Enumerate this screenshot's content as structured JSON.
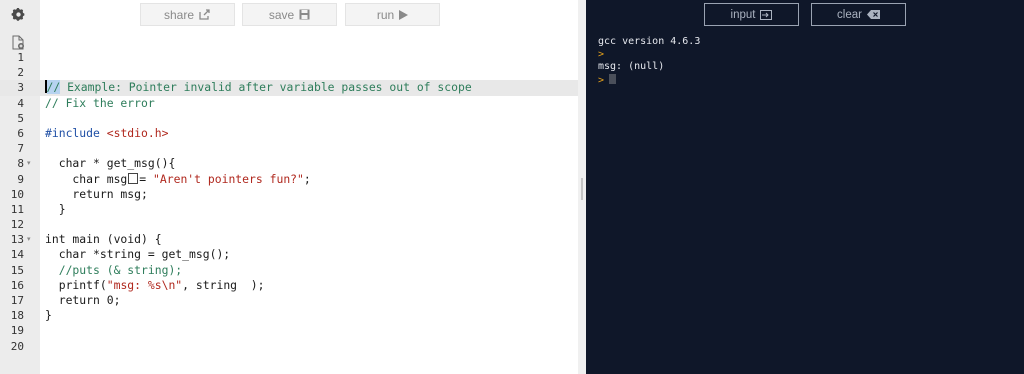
{
  "toolbar": {
    "share_label": "share",
    "save_label": "save",
    "run_label": "run"
  },
  "console_toolbar": {
    "input_label": "input",
    "clear_label": "clear"
  },
  "icons": {
    "settings": "gear-icon",
    "new_file": "new-file-icon",
    "share": "share-out-icon",
    "save": "floppy-disk-icon",
    "run": "play-triangle-icon",
    "input": "input-arrow-icon",
    "clear": "backspace-icon"
  },
  "colors": {
    "console_bg": "#0f1729",
    "gutter_bg": "#ececec",
    "comment": "#2e7d5b",
    "string": "#b0281e",
    "prompt": "#e5a01a"
  },
  "editor": {
    "active_line": 3,
    "lines": [
      {
        "no": "1",
        "fold": ""
      },
      {
        "no": "2",
        "fold": ""
      },
      {
        "no": "3",
        "fold": ""
      },
      {
        "no": "4",
        "fold": ""
      },
      {
        "no": "5",
        "fold": ""
      },
      {
        "no": "6",
        "fold": ""
      },
      {
        "no": "7",
        "fold": ""
      },
      {
        "no": "8",
        "fold": "▾"
      },
      {
        "no": "9",
        "fold": ""
      },
      {
        "no": "10",
        "fold": ""
      },
      {
        "no": "11",
        "fold": ""
      },
      {
        "no": "12",
        "fold": ""
      },
      {
        "no": "13",
        "fold": "▾"
      },
      {
        "no": "14",
        "fold": ""
      },
      {
        "no": "15",
        "fold": ""
      },
      {
        "no": "16",
        "fold": ""
      },
      {
        "no": "17",
        "fold": ""
      },
      {
        "no": "18",
        "fold": ""
      },
      {
        "no": "19",
        "fold": ""
      },
      {
        "no": "20",
        "fold": ""
      }
    ],
    "code": {
      "l3_sel": "//",
      "l3_rest": "Example: Pointer invalid after variable passes out of scope",
      "l4": "// Fix the error",
      "l6_inc": "#include",
      "l6_hdr": "<stdio.h>",
      "l8": "  char * get_msg(){",
      "l9_a": "    char msg",
      "l9_b": "= ",
      "l9_str": "\"Aren't pointers fun?\"",
      "l9_c": ";",
      "l10": "    return msg;",
      "l11": "  }",
      "l13": "int main (void) {",
      "l14": "  char *string = get_msg();",
      "l15": "  //puts (& string);",
      "l16_a": "  printf(",
      "l16_str": "\"msg: %s\\n\"",
      "l16_b": ", string  );",
      "l17": "  return 0;",
      "l18": "}"
    }
  },
  "console": {
    "line1": "gcc version 4.6.3",
    "prompt": ">",
    "line3": "msg: (null)",
    "prompt_input": ">"
  }
}
